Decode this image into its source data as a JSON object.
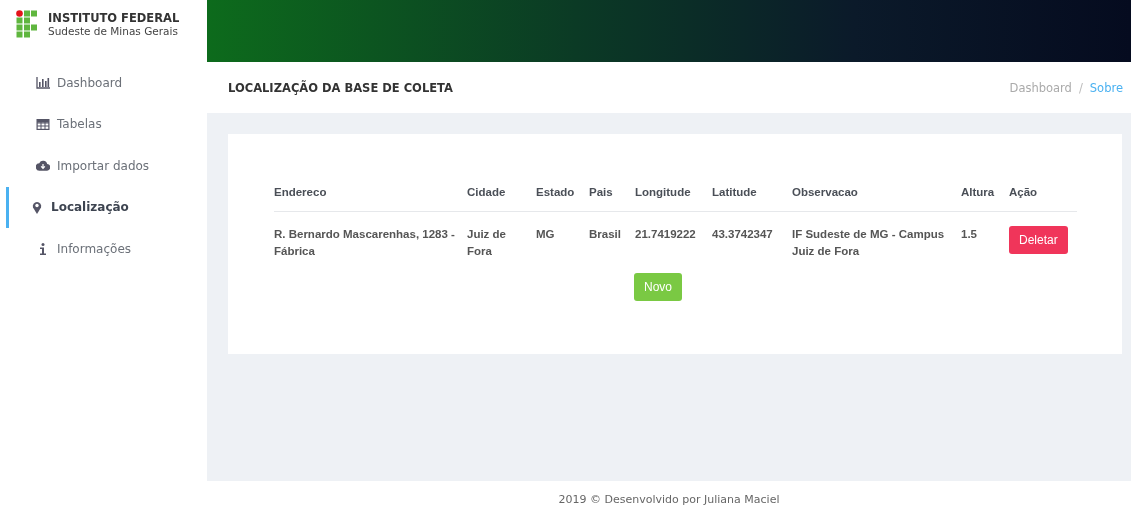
{
  "brand": {
    "title": "INSTITUTO FEDERAL",
    "subtitle": "Sudeste de Minas Gerais"
  },
  "sidebar": {
    "items": [
      {
        "label": "Dashboard",
        "selected": false
      },
      {
        "label": "Tabelas",
        "selected": false
      },
      {
        "label": "Importar dados",
        "selected": false
      },
      {
        "label": "Localização",
        "selected": true
      },
      {
        "label": "Informações",
        "selected": false
      }
    ]
  },
  "page_title": "LOCALIZAÇÃO DA BASE DE COLETA",
  "breadcrumb": [
    {
      "label": "Dashboard",
      "selected": false
    },
    {
      "label": "Sobre",
      "selected": true
    }
  ],
  "breadcrumb_separator": "/",
  "table": {
    "columns": [
      "Endereco",
      "Cidade",
      "Estado",
      "Pais",
      "Longitude",
      "Latitude",
      "Observacao",
      "Altura",
      "Ação"
    ],
    "rows": [
      {
        "cells": [
          "R. Bernardo Mascarenhas, 1283 - Fábrica",
          "Juiz de Fora",
          "MG",
          "Brasil",
          "21.7419222",
          "43.3742347",
          "IF Sudeste de MG - Campus Juiz de Fora",
          "1.5"
        ],
        "action": "Deletar"
      }
    ]
  },
  "new_button": "Novo",
  "footer": "2019 © Desenvolvido por Juliana Maciel"
}
